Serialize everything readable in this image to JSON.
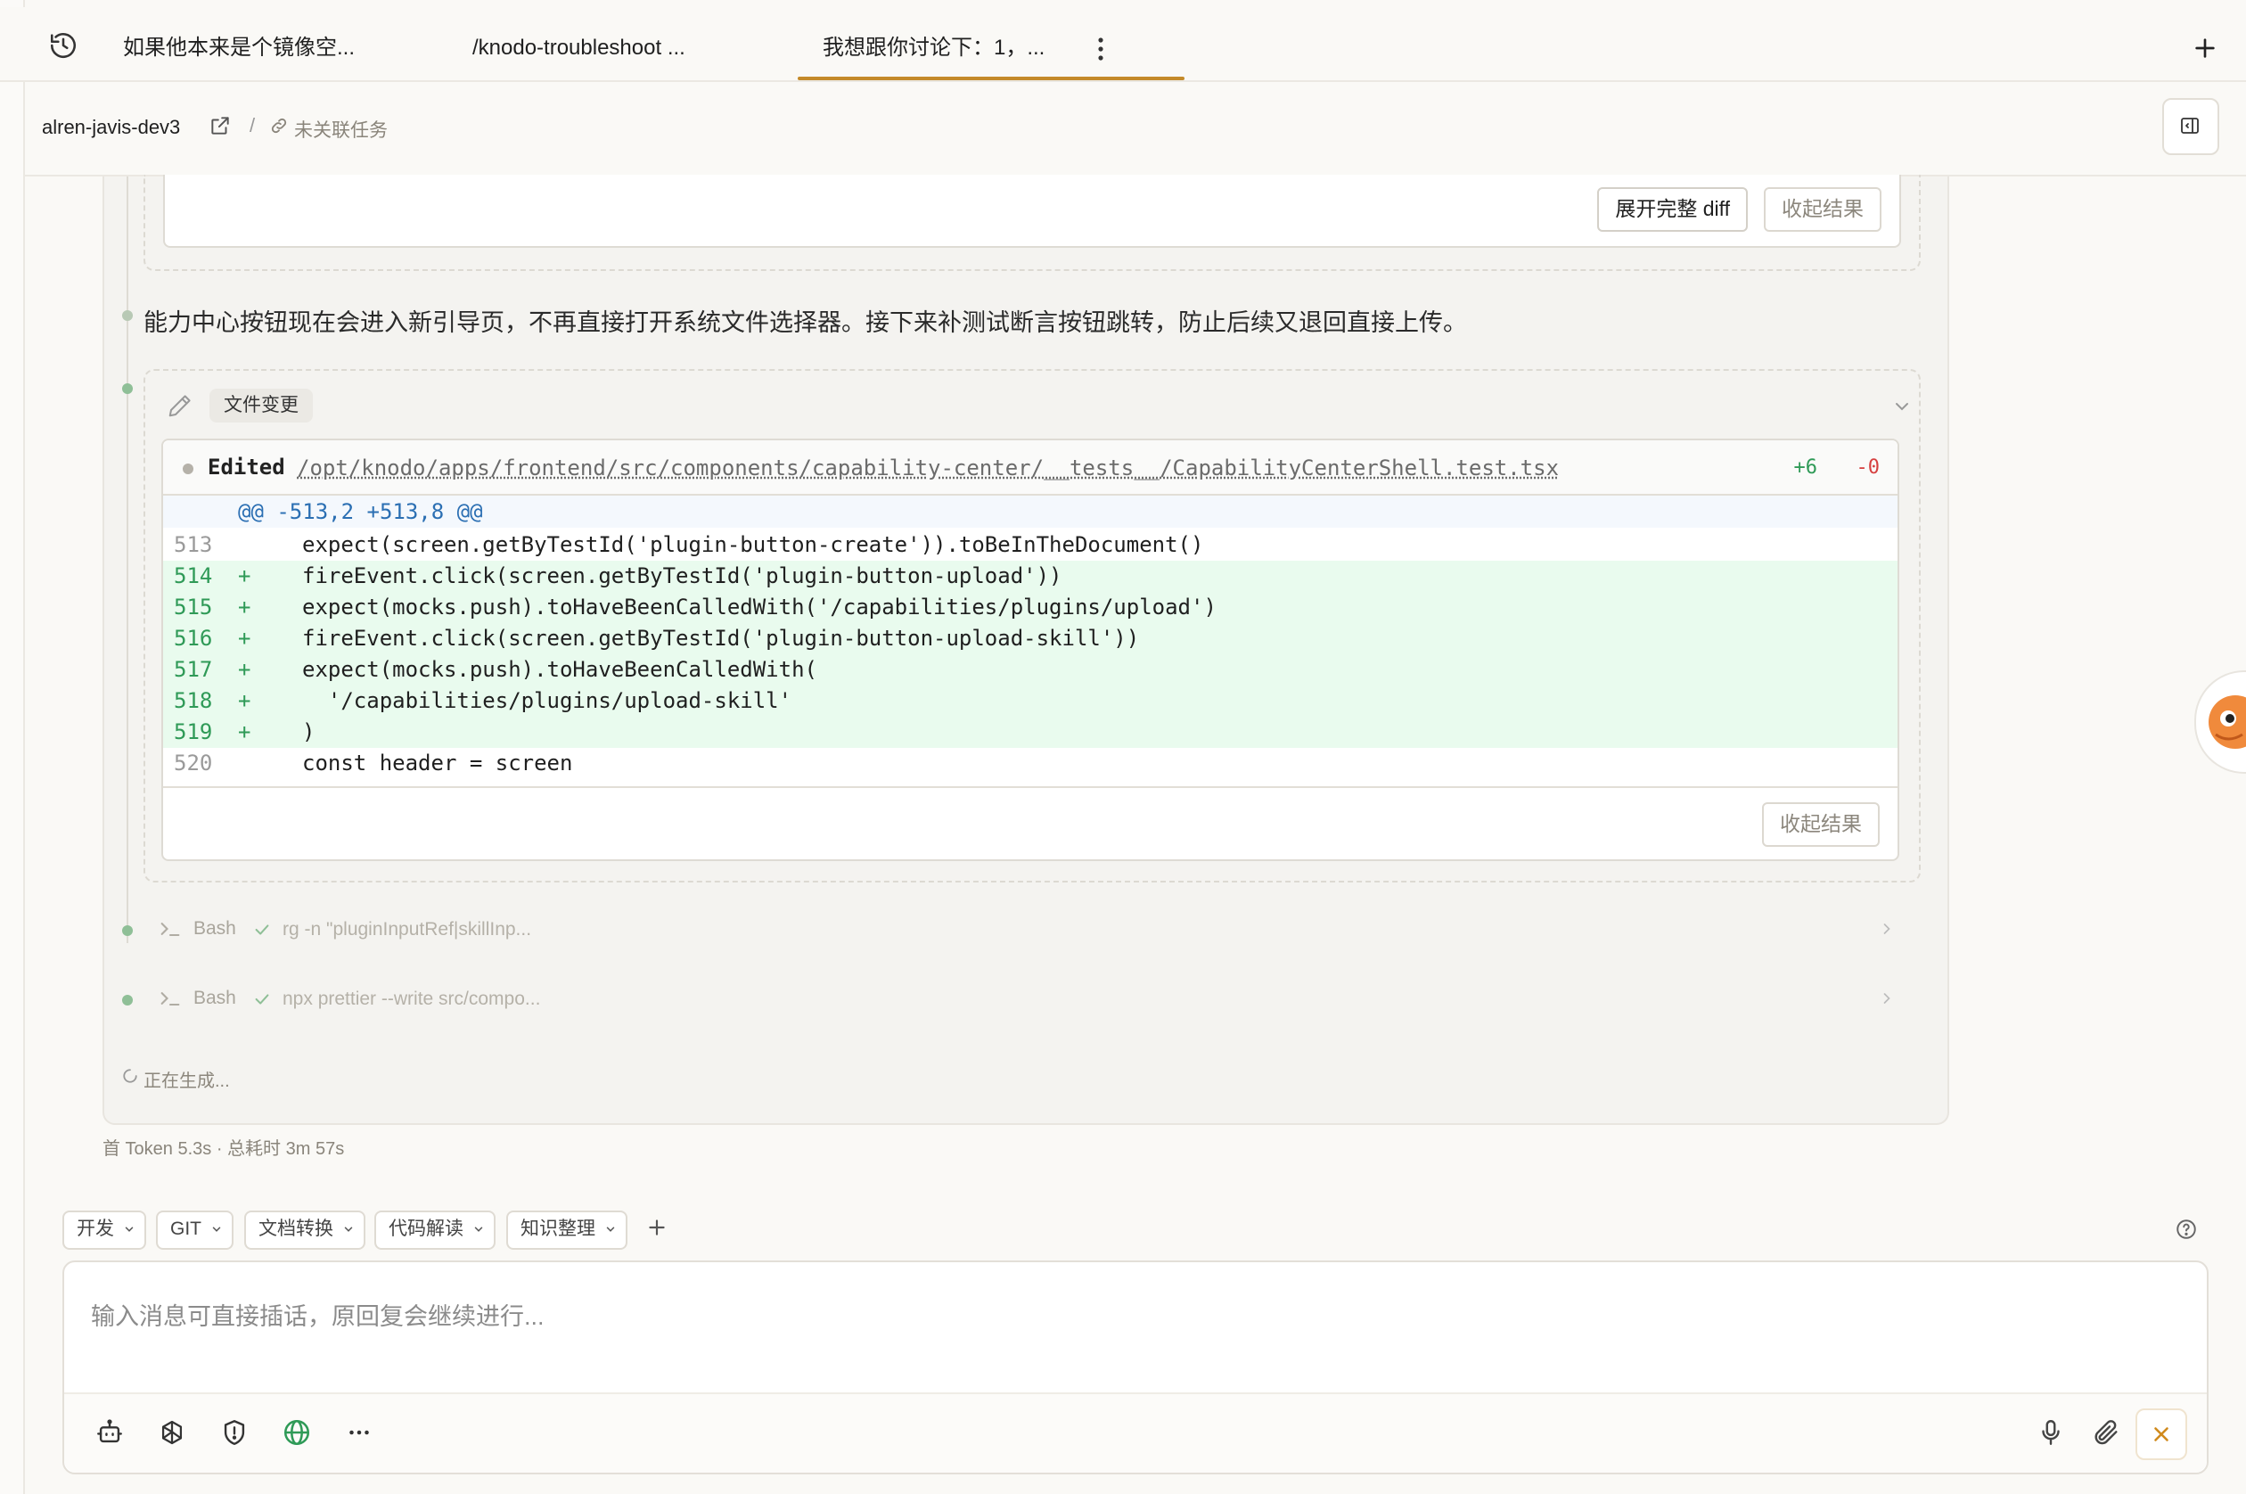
{
  "tabs": [
    {
      "label": "如果他本来是个镜像空..."
    },
    {
      "label": "/knodo-troubleshoot ..."
    },
    {
      "label": "我想跟你讨论下：1，..."
    }
  ],
  "breadcrumb": {
    "workspace": "alren-javis-dev3",
    "separator": "/",
    "task": "未关联任务"
  },
  "top_result": {
    "expand_label": "展开完整 diff",
    "collapse_label": "收起结果"
  },
  "message": "能力中心按钮现在会进入新引导页，不再直接打开系统文件选择器。接下来补测试断言按钮跳转，防止后续又退回直接上传。",
  "file_change": {
    "tag": "文件变更",
    "edited_label": "Edited",
    "path": "/opt/knodo/apps/frontend/src/components/capability-center/__tests__/CapabilityCenterShell.test.tsx",
    "additions": "+6",
    "deletions": "-0",
    "hunk": "@@ -513,2 +513,8 @@",
    "lines": [
      {
        "num": "513",
        "sign": "",
        "code": "expect(screen.getByTestId('plugin-button-create')).toBeInTheDocument()",
        "type": "ctx"
      },
      {
        "num": "514",
        "sign": "+",
        "code": "fireEvent.click(screen.getByTestId('plugin-button-upload'))",
        "type": "add"
      },
      {
        "num": "515",
        "sign": "+",
        "code": "expect(mocks.push).toHaveBeenCalledWith('/capabilities/plugins/upload')",
        "type": "add"
      },
      {
        "num": "516",
        "sign": "+",
        "code": "fireEvent.click(screen.getByTestId('plugin-button-upload-skill'))",
        "type": "add"
      },
      {
        "num": "517",
        "sign": "+",
        "code": "expect(mocks.push).toHaveBeenCalledWith(",
        "type": "add"
      },
      {
        "num": "518",
        "sign": "+",
        "code": "  '/capabilities/plugins/upload-skill'",
        "type": "add"
      },
      {
        "num": "519",
        "sign": "+",
        "code": ")",
        "type": "add"
      },
      {
        "num": "520",
        "sign": "",
        "code": "const header = screen",
        "type": "ctx"
      }
    ],
    "collapse_label": "收起结果"
  },
  "bash_runs": [
    {
      "label": "Bash",
      "command": "rg -n \"pluginInputRef|skillInp..."
    },
    {
      "label": "Bash",
      "command": "npx prettier --write src/compo..."
    }
  ],
  "generating": "正在生成...",
  "stats": "首 Token 5.3s · 总耗时 3m 57s",
  "shortcuts": [
    "开发",
    "GIT",
    "文档转换",
    "代码解读",
    "知识整理"
  ],
  "composer": {
    "placeholder": "输入消息可直接插话，原回复会继续进行..."
  },
  "colors": {
    "accent": "#c48a2a",
    "add_green": "#2f9a57",
    "delete_red": "#d64040",
    "add_bg": "#e9fbee"
  }
}
